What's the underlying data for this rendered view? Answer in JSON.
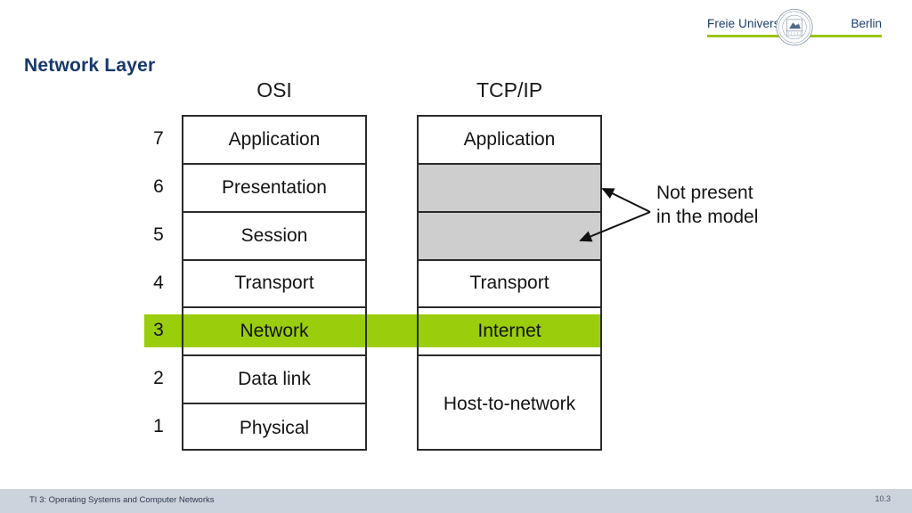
{
  "brand": {
    "left_word": "Freie Universität",
    "right_word": "Berlin",
    "seal_name": "fu-berlin-seal",
    "accent_color": "#9ac412",
    "text_color": "#1a3d6d"
  },
  "slide": {
    "title": "Network Layer",
    "title_color": "#16386b"
  },
  "diagram": {
    "headers": {
      "osi": "OSI",
      "tcpip": "TCP/IP"
    },
    "layer_numbers": [
      "7",
      "6",
      "5",
      "4",
      "3",
      "2",
      "1"
    ],
    "osi_layers": [
      {
        "number": "7",
        "label": "Application"
      },
      {
        "number": "6",
        "label": "Presentation"
      },
      {
        "number": "5",
        "label": "Session"
      },
      {
        "number": "4",
        "label": "Transport"
      },
      {
        "number": "3",
        "label": "Network"
      },
      {
        "number": "2",
        "label": "Data link"
      },
      {
        "number": "1",
        "label": "Physical"
      }
    ],
    "tcpip_layers": [
      {
        "label": "Application",
        "style": "normal",
        "span": 1
      },
      {
        "label": "",
        "style": "gray",
        "span": 1
      },
      {
        "label": "",
        "style": "gray",
        "span": 1
      },
      {
        "label": "Transport",
        "style": "normal",
        "span": 1
      },
      {
        "label": "Internet",
        "style": "highlight",
        "span": 1
      },
      {
        "label": "Host-to-network",
        "style": "normal",
        "span": 2
      }
    ],
    "highlight": {
      "label": "Network layer highlight",
      "color": "#9acd0b",
      "osi_row": "Network",
      "tcpip_row": "Internet"
    },
    "gray_cell_color": "#cecece",
    "callout": {
      "line1": "Not present",
      "line2": "in the model"
    }
  },
  "footer": {
    "course": "TI 3: Operating Systems and Computer Networks",
    "page": "10.3",
    "bar_color": "#ccd3dd"
  }
}
